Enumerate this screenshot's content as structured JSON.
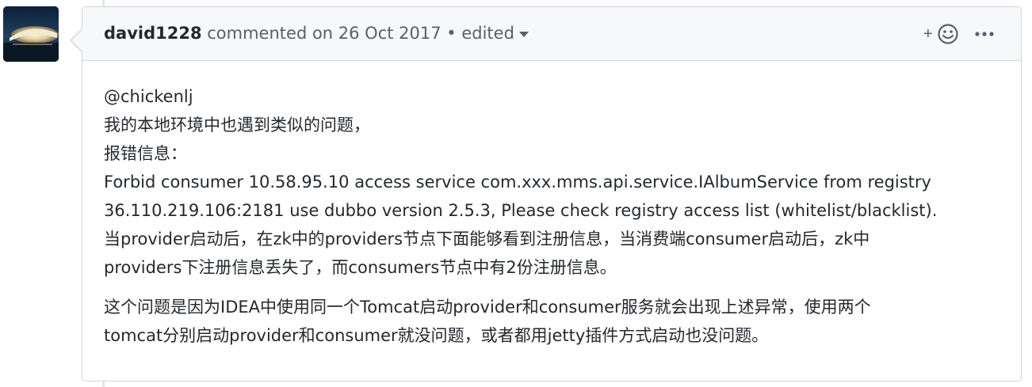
{
  "comment": {
    "author": "david1228",
    "meta": " commented on 26 Oct 2017 • edited",
    "actions": {
      "add_reaction_icon": "smiley-plus-icon",
      "more_icon": "kebab-horizontal-icon"
    },
    "body": {
      "mention": "@chickenlj",
      "line1": "我的本地环境中也遇到类似的问题，",
      "line2": "报错信息：",
      "line3": "Forbid consumer 10.58.95.10 access service com.xxx.mms.api.service.IAlbumService from registry",
      "line4": "36.110.219.106:2181 use dubbo version 2.5.3, Please check registry access list (whitelist/blacklist).",
      "line5": "当provider启动后，在zk中的providers节点下面能够看到注册信息，当消费端consumer启动后，zk中",
      "line6": "providers下注册信息丢失了，而consumers节点中有2份注册信息。",
      "line7": "这个问题是因为IDEA中使用同一个Tomcat启动provider和consumer服务就会出现上述异常，使用两个",
      "line8": "tomcat分别启动provider和consumer就没问题，或者都用jetty插件方式启动也没问题。"
    }
  },
  "colors": {
    "header_bg": "#f6f8fa",
    "border": "#d1d5da",
    "text": "#24292e",
    "muted": "#586069"
  }
}
